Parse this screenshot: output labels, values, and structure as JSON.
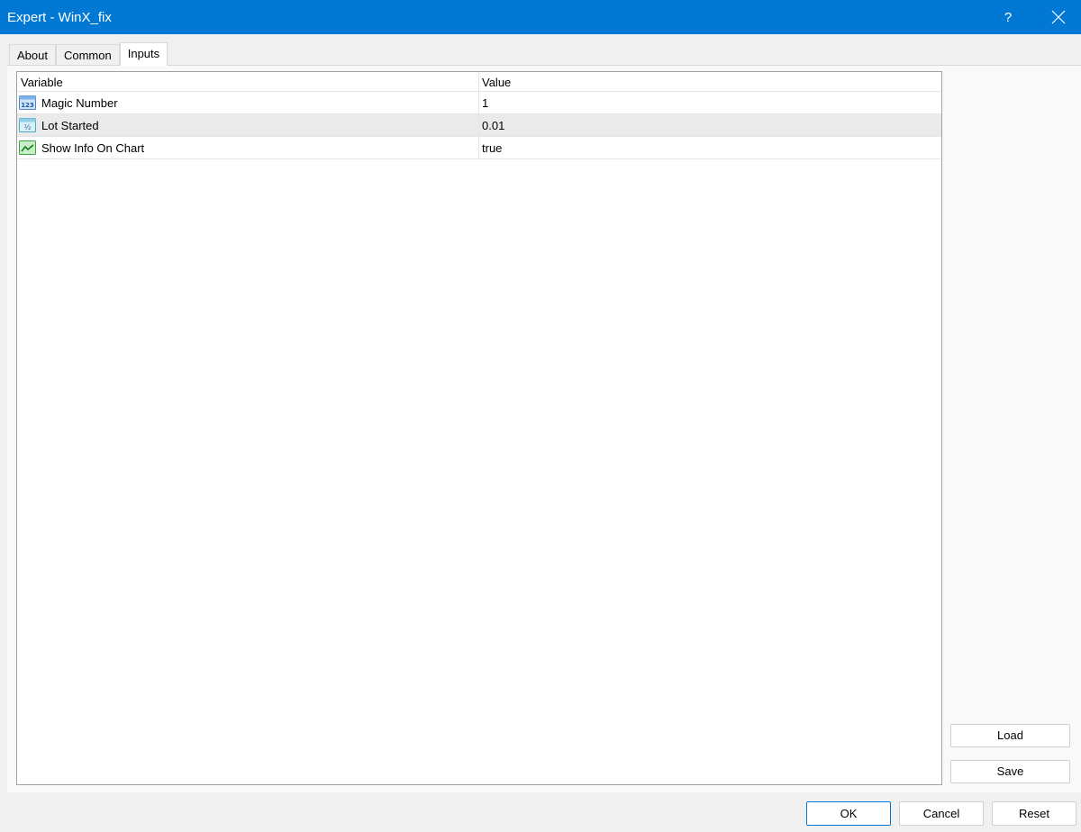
{
  "window": {
    "title": "Expert - WinX_fix",
    "help_label": "?"
  },
  "tabs": [
    {
      "label": "About"
    },
    {
      "label": "Common"
    },
    {
      "label": "Inputs",
      "active": true
    }
  ],
  "grid": {
    "columns": {
      "variable": "Variable",
      "value": "Value"
    },
    "rows": [
      {
        "icon": "integer-123-icon",
        "variable": "Magic Number",
        "value": "1"
      },
      {
        "icon": "fraction-half-icon",
        "variable": "Lot Started",
        "value": "0.01",
        "selected": true
      },
      {
        "icon": "boolean-chart-icon",
        "variable": "Show Info On Chart",
        "value": "true"
      }
    ]
  },
  "side_buttons": {
    "load": "Load",
    "save": "Save"
  },
  "dialog_buttons": {
    "ok": "OK",
    "cancel": "Cancel",
    "reset": "Reset"
  },
  "colors": {
    "titlebar": "#0078d4",
    "selected_row": "#eaeaea"
  }
}
